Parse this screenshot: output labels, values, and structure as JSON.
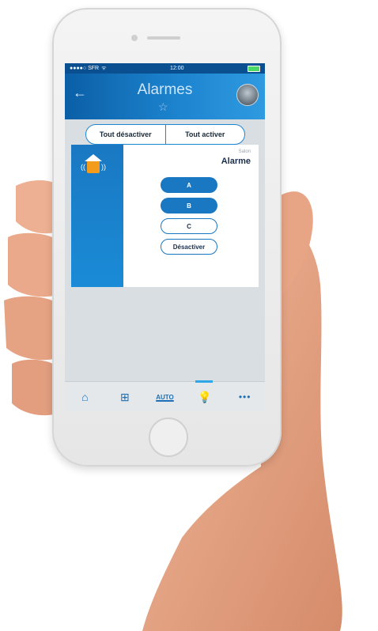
{
  "status": {
    "carrier": "●●●●○ SFR",
    "wifi": "wifi-icon",
    "time": "12:00",
    "battery_color": "#4cd964"
  },
  "header": {
    "back_icon": "back-arrow-icon",
    "title": "Alarmes",
    "favorite_icon": "star-outline-icon",
    "avatar_icon": "house-photo-avatar"
  },
  "toggle": {
    "deactivate_all": "Tout désactiver",
    "activate_all": "Tout activer"
  },
  "card": {
    "room": "Salon",
    "title": "Alarme",
    "icon": "alarm-house-icon",
    "options": [
      {
        "label": "A",
        "state": "selected"
      },
      {
        "label": "B",
        "state": "selected"
      },
      {
        "label": "C",
        "state": "unselected"
      },
      {
        "label": "Désactiver",
        "state": "unselected"
      }
    ]
  },
  "tabbar": {
    "tabs": [
      {
        "icon": "home-icon"
      },
      {
        "icon": "room-layout-icon"
      },
      {
        "label": "AUTO"
      },
      {
        "icon": "light-radiator-icon",
        "active": true
      },
      {
        "icon": "more-icon"
      }
    ]
  },
  "colors": {
    "brand_blue": "#1a78c2",
    "header_gradient_start": "#0b5fa6",
    "header_gradient_end": "#2f9ae0",
    "active_tab_indicator": "#2fa6e8",
    "alarm_house_orange": "#f39b1b"
  }
}
